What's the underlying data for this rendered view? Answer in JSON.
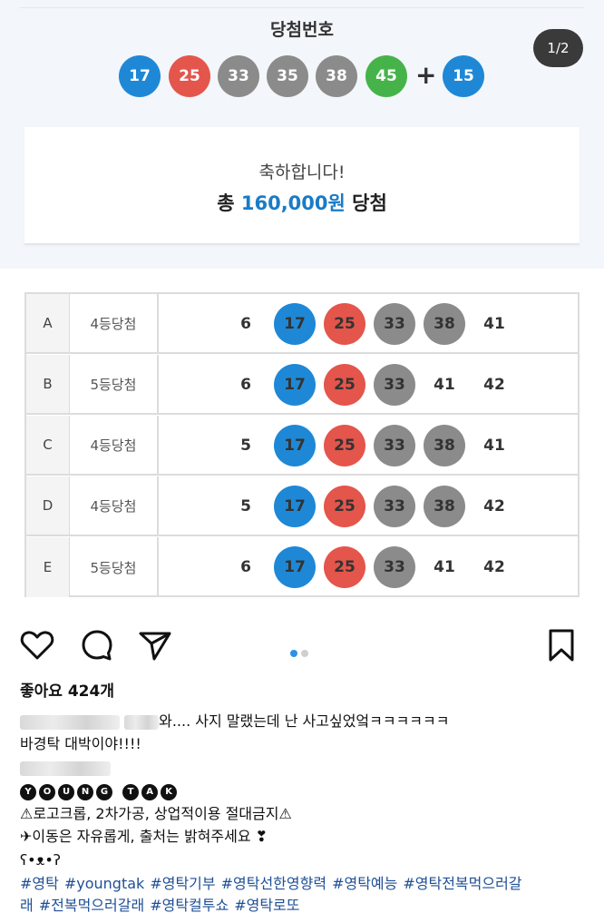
{
  "draw": {
    "title": "당첨번호",
    "page_indicator": "1/2",
    "numbers": [
      {
        "value": "17",
        "color": "#1e88d6",
        "cls": "blue"
      },
      {
        "value": "25",
        "color": "#e4554b",
        "cls": "red"
      },
      {
        "value": "33",
        "color": "#8b8b8b",
        "cls": "gray"
      },
      {
        "value": "35",
        "color": "#8b8b8b",
        "cls": "gray"
      },
      {
        "value": "38",
        "color": "#8b8b8b",
        "cls": "gray"
      },
      {
        "value": "45",
        "color": "#46b34a",
        "cls": "green"
      }
    ],
    "plus": "+",
    "bonus": {
      "value": "15",
      "color": "#1e88d6",
      "cls": "blue"
    }
  },
  "result": {
    "congrats": "축하합니다!",
    "prize_prefix": "총 ",
    "prize_amount": "160,000원",
    "prize_suffix": " 당첨"
  },
  "rows": [
    {
      "letter": "A",
      "rank": "4등당첨",
      "nums": [
        {
          "v": "6",
          "hit": ""
        },
        {
          "v": "17",
          "hit": "blue"
        },
        {
          "v": "25",
          "hit": "red"
        },
        {
          "v": "33",
          "hit": "gray"
        },
        {
          "v": "38",
          "hit": "gray"
        },
        {
          "v": "41",
          "hit": ""
        }
      ]
    },
    {
      "letter": "B",
      "rank": "5등당첨",
      "nums": [
        {
          "v": "6",
          "hit": ""
        },
        {
          "v": "17",
          "hit": "blue"
        },
        {
          "v": "25",
          "hit": "red"
        },
        {
          "v": "33",
          "hit": "gray"
        },
        {
          "v": "41",
          "hit": ""
        },
        {
          "v": "42",
          "hit": ""
        }
      ]
    },
    {
      "letter": "C",
      "rank": "4등당첨",
      "nums": [
        {
          "v": "5",
          "hit": ""
        },
        {
          "v": "17",
          "hit": "blue"
        },
        {
          "v": "25",
          "hit": "red"
        },
        {
          "v": "33",
          "hit": "gray"
        },
        {
          "v": "38",
          "hit": "gray"
        },
        {
          "v": "41",
          "hit": ""
        }
      ]
    },
    {
      "letter": "D",
      "rank": "4등당첨",
      "nums": [
        {
          "v": "5",
          "hit": ""
        },
        {
          "v": "17",
          "hit": "blue"
        },
        {
          "v": "25",
          "hit": "red"
        },
        {
          "v": "33",
          "hit": "gray"
        },
        {
          "v": "38",
          "hit": "gray"
        },
        {
          "v": "42",
          "hit": ""
        }
      ]
    },
    {
      "letter": "E",
      "rank": "5등당첨",
      "nums": [
        {
          "v": "6",
          "hit": ""
        },
        {
          "v": "17",
          "hit": "blue"
        },
        {
          "v": "25",
          "hit": "red"
        },
        {
          "v": "33",
          "hit": "gray"
        },
        {
          "v": "41",
          "hit": ""
        },
        {
          "v": "42",
          "hit": ""
        }
      ]
    }
  ],
  "post": {
    "likes": "좋아요 424개",
    "comment_line1": "와.... 사지 말랬는데 난 사고싶었엌ㅋㅋㅋㅋㅋㅋ",
    "comment_line2": "바경탁 대박이야!!!!",
    "young_letters": [
      "Y",
      "O",
      "U",
      "N",
      "G"
    ],
    "tak_letters": [
      "T",
      "A",
      "K"
    ],
    "notice1": "⚠로고크롭, 2차가공, 상업적이용 절대금지⚠",
    "notice2": "✈이동은 자유롭게, 출처는 밝혀주세요 ❣",
    "emoticon": "ʕ•ᴥ•ʔ",
    "hashtags": [
      "#영탁",
      "#youngtak",
      "#영탁기부",
      "#영탁선한영향력",
      "#영탁예능",
      "#영탁전복먹으러갈",
      "래",
      "#전복먹으러갈래",
      "#영탁컬투쇼",
      "#영탁로또"
    ]
  },
  "icons": {
    "like": "heart-icon",
    "comment": "comment-bubble-icon",
    "share": "paper-plane-icon",
    "save": "bookmark-icon"
  }
}
